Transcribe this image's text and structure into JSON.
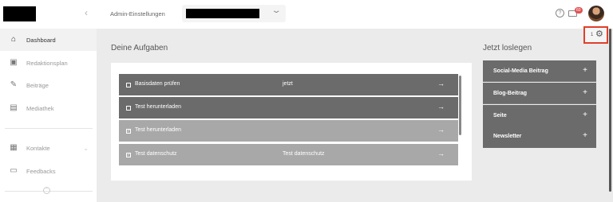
{
  "header": {
    "admin_label": "Admin-Einstellungen",
    "collapse_glyph": "‹",
    "select_chevron": "⌄",
    "help_glyph": "?",
    "notification_count": "60"
  },
  "sidebar": {
    "items": [
      {
        "label": "Dashboard",
        "icon": "⌂",
        "active": true
      },
      {
        "label": "Redaktionsplan",
        "icon": "▣"
      },
      {
        "label": "Beiträge",
        "icon": "✎"
      },
      {
        "label": "Mediathek",
        "icon": "▤"
      },
      {
        "label": "Kontakte",
        "icon": "▦"
      },
      {
        "label": "Feedbacks",
        "icon": "▭"
      }
    ],
    "kontakte_chevron": "⌄",
    "collapse_glyph": "⌃"
  },
  "tasks": {
    "title": "Deine Aufgaben",
    "items": [
      {
        "label": "Basisdaten prüfen",
        "meta": "jetzt",
        "checked": false,
        "arrow": "→"
      },
      {
        "label": "Test herunterladen",
        "meta": "",
        "checked": false,
        "arrow": "→"
      },
      {
        "label": "Test herunterladen",
        "meta": "",
        "checked": true,
        "arrow": "→"
      },
      {
        "label": "Test datenschutz",
        "meta": "Test datenschutz",
        "checked": true,
        "arrow": "→"
      }
    ]
  },
  "quickstart": {
    "title": "Jetzt loslegen",
    "items": [
      {
        "label": "Social-Media Beitrag",
        "plus": "+"
      },
      {
        "label": "Blog-Beitrag",
        "plus": "+"
      },
      {
        "label": "Seite",
        "plus": "+"
      },
      {
        "label": "Newsletter",
        "plus": "+"
      }
    ]
  },
  "settings_widget": {
    "count": "1",
    "gear_glyph": "⚙"
  },
  "colors": {
    "accent_red": "#e0402a",
    "task_dark": "#6b6b6b",
    "task_done": "#a8a8a8",
    "badge": "#e05252"
  }
}
